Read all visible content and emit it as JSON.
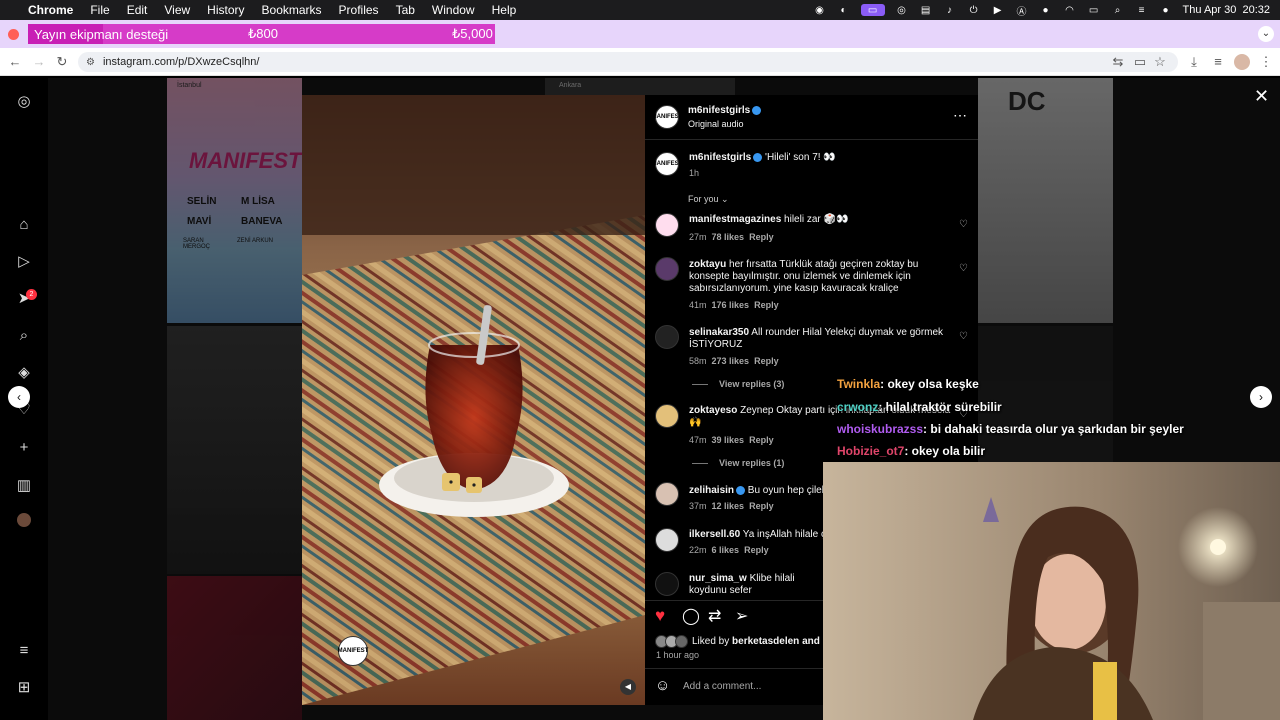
{
  "menubar": {
    "app": "Chrome",
    "items": [
      "File",
      "Edit",
      "View",
      "History",
      "Bookmarks",
      "Profiles",
      "Tab",
      "Window",
      "Help"
    ],
    "datetime": "Thu Apr 30  20:32"
  },
  "donation_bar": {
    "label": "Yayın ekipmanı desteği",
    "current": "₺800",
    "goal": "₺5,000",
    "progress": 0.16
  },
  "browser": {
    "url": "instagram.com/p/DXwzeCsqlhn/"
  },
  "sidebar": {
    "notification_count": "2"
  },
  "post": {
    "author": "m6nifestgirls",
    "audio": "Original audio",
    "caption_user": "m6nifestgirls",
    "caption": "'Hileli' son 7! 👀",
    "caption_time": "1h",
    "sort_label": "For you",
    "liked_by_prefix": "Liked by",
    "liked_by_user": "berketasdelen",
    "liked_by_suffix": "and 1:",
    "time_ago": "1 hour ago",
    "comment_placeholder": "Add a comment...",
    "avatar_text": "MANIFEST"
  },
  "comments": [
    {
      "user": "manifestmagazines",
      "text": "hileli zar 🎲👀",
      "time": "27m",
      "likes": "78 likes",
      "reply": "Reply"
    },
    {
      "user": "zoktayu",
      "text": "her fırsatta Türklük atağı geçiren zoktay bu konsepte bayılmıştır. onu izlemek ve dinlemek için sabırsızlanıyorum. yine kasıp kavuracak kraliçe",
      "time": "41m",
      "likes": "176 likes",
      "reply": "Reply"
    },
    {
      "user": "selinakar350",
      "text": "All rounder Hilal Yelekçi duymak ve görmek İSTİYORUZ",
      "time": "58m",
      "likes": "273 likes",
      "reply": "Reply",
      "view_replies": "View replies (3)"
    },
    {
      "user": "zoktayeso",
      "text": "Zeynep Oktay partı için inkılaptan olduk mesela 🙌",
      "time": "47m",
      "likes": "39 likes",
      "reply": "Reply",
      "view_replies": "View replies (1)"
    },
    {
      "user": "zelihaisin",
      "text": "Bu oyun hep çileli,",
      "time": "37m",
      "likes": "12 likes",
      "reply": "Reply"
    },
    {
      "user": "ilkersell.60",
      "text": "Ya inşAllah hilale ço",
      "time": "22m",
      "likes": "6 likes",
      "reply": "Reply"
    },
    {
      "user": "nur_sima_w",
      "text": "Klibe hilali koydunu sefer",
      "time": "",
      "likes": "",
      "reply": ""
    }
  ],
  "chat": [
    {
      "user": "Twinkla",
      "text": ": okey olsa keşke",
      "color": "#f4a340"
    },
    {
      "user": "crwonz",
      "text": ": hilal traktör sürebilir",
      "color": "#4fd1c5"
    },
    {
      "user": "whoiskubrazss",
      "text": ": bi dahaki teasırda olur ya şarkıdan bir şeyler",
      "color": "#b05cf0"
    },
    {
      "user": "Hobizie_ot7",
      "text": ": okey ola bilir",
      "color": "#e0456a"
    }
  ],
  "grid_text": {
    "brand": "MANIFEST",
    "t1": "İstanbul",
    "t2": "Ankara",
    "names": [
      "SELİN",
      "M LİSA",
      "MAVİ",
      "BANEVA",
      "SARAN MERGOÇ",
      "ZENİ ARKUN"
    ],
    "dc": "DC"
  }
}
